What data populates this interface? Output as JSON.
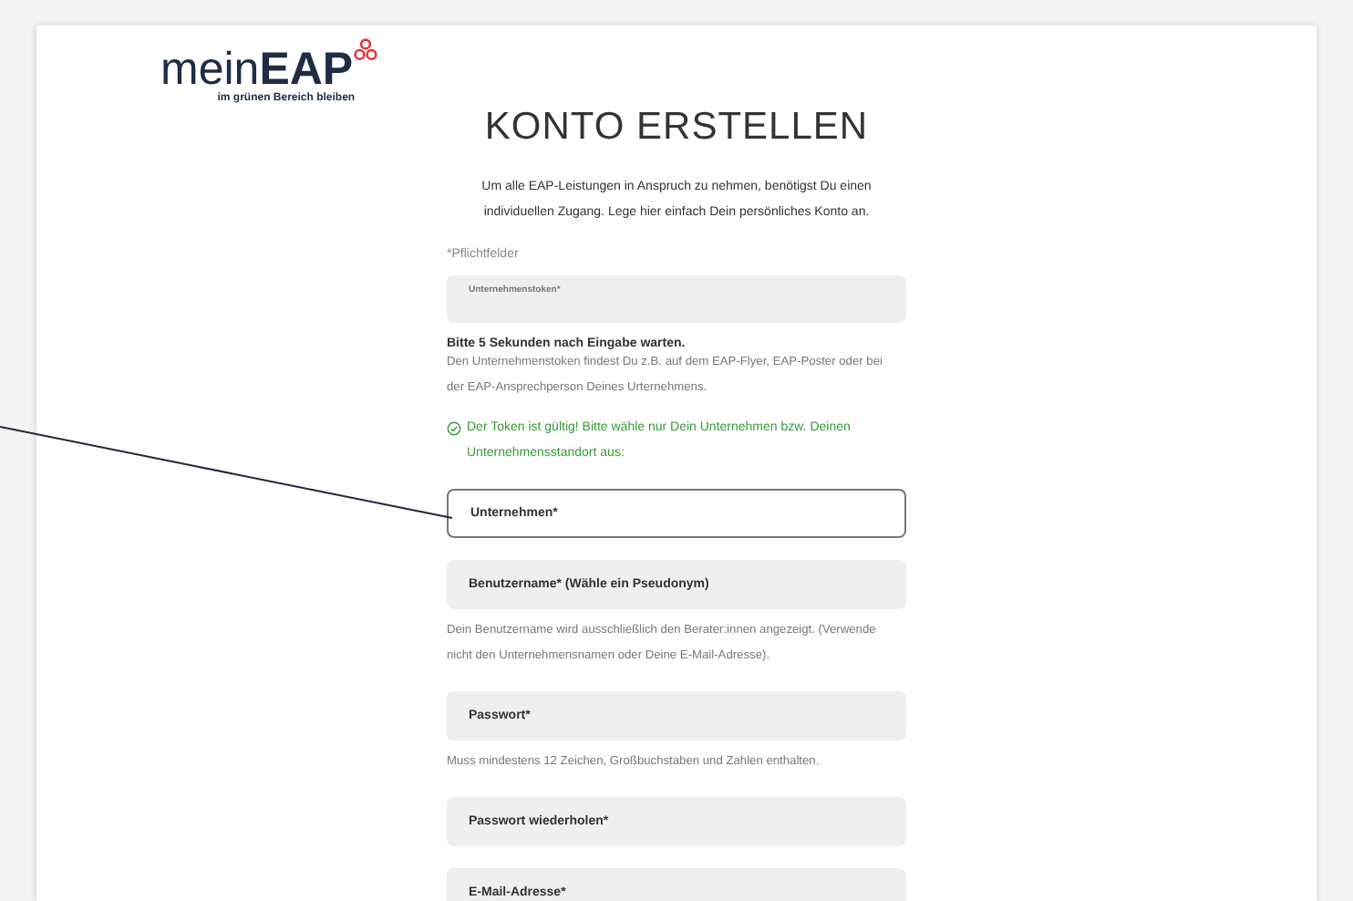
{
  "logo": {
    "light": "mein",
    "bold": "EAP",
    "tagline": "im grünen Bereich bleiben"
  },
  "title": "KONTO ERSTELLEN",
  "intro": "Um alle EAP-Leistungen in Anspruch zu nehmen, benötigst Du einen individuellen Zugang. Lege hier einfach Dein persönliches Konto an.",
  "required_note": "*Pflichtfelder",
  "form": [
    {
      "kind": "floating-field",
      "label": "Unternehmenstoken*",
      "focused": false
    },
    {
      "kind": "note",
      "strong": "Bitte 5 Sekunden nach Eingabe warten.",
      "text": "Den Unternehmenstoken findest Du z.B. auf dem EAP-Flyer, EAP-Poster oder bei der EAP-Ansprechperson Deines Urternehmens."
    },
    {
      "kind": "success",
      "text": "Der Token ist gültig! Bitte wähle nur Dein Unternehmen bzw. Deinen Unternehmensstandort aus:"
    },
    {
      "kind": "field",
      "label": "Unternehmen*",
      "focused": true,
      "annotated": true
    },
    {
      "kind": "field",
      "label": "Benutzername* (Wähle ein Pseudonym)",
      "focused": false
    },
    {
      "kind": "note",
      "text": "Dein Benutzername wird ausschließlich den Berater:innen angezeigt. (Verwende nicht den Unternehmensnamen oder Deine E-Mail-Adresse)."
    },
    {
      "kind": "field",
      "label": "Passwort*",
      "focused": false
    },
    {
      "kind": "note",
      "text": "Muss mindestens 12 Zeichen, Großbuchstaben und Zahlen enthalten."
    },
    {
      "kind": "field",
      "label": "Passwort wiederholen*",
      "focused": false
    },
    {
      "kind": "field",
      "label": "E-Mail-Adresse*",
      "focused": false
    }
  ]
}
